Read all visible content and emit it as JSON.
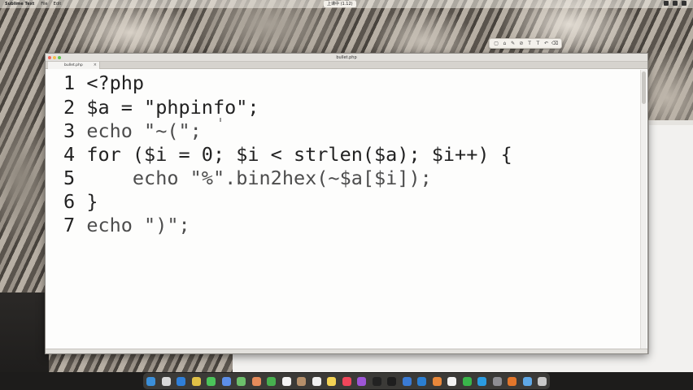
{
  "menubar": {
    "app_name": "Sublime Text",
    "items": [
      "File",
      "Edit"
    ],
    "center_label": "上课中 (1.12)"
  },
  "window": {
    "title": "bullet.php",
    "tab_label": "bullet.php",
    "tab_close": "×"
  },
  "editor": {
    "lines": [
      {
        "no": "1",
        "code": "<?php"
      },
      {
        "no": "2",
        "code": "$a = \"phpinfo\";"
      },
      {
        "no": "3",
        "code": "echo \"~(\";"
      },
      {
        "no": "4",
        "code": "for ($i = 0; $i < strlen($a); $i++) {"
      },
      {
        "no": "5",
        "code": "    echo \"%\".bin2hex(~$a[$i]);"
      },
      {
        "no": "6",
        "code": "}"
      },
      {
        "no": "7",
        "code": "echo \")\";"
      }
    ]
  },
  "float_toolbar": {
    "tools": [
      "▢",
      "⌂",
      "✎",
      "⊘",
      "T",
      "T",
      "↶",
      "⌫"
    ]
  },
  "dock": {
    "icons": [
      {
        "name": "finder-icon",
        "color": "#3b8fd9"
      },
      {
        "name": "launchpad-icon",
        "color": "#d9d9d9"
      },
      {
        "name": "safari-icon",
        "color": "#2f7fd8"
      },
      {
        "name": "chrome-icon",
        "color": "#e0c146"
      },
      {
        "name": "messages-icon",
        "color": "#4bc35a"
      },
      {
        "name": "mail-icon",
        "color": "#5c8ee8"
      },
      {
        "name": "maps-icon",
        "color": "#6cbf6b"
      },
      {
        "name": "photos-icon",
        "color": "#e58b5a"
      },
      {
        "name": "facetime-icon",
        "color": "#47b04f"
      },
      {
        "name": "calendar-icon",
        "color": "#f4f4f4"
      },
      {
        "name": "contacts-icon",
        "color": "#b58f6a"
      },
      {
        "name": "reminders-icon",
        "color": "#f0f0f0"
      },
      {
        "name": "notes-icon",
        "color": "#f3d354"
      },
      {
        "name": "music-icon",
        "color": "#f0465a"
      },
      {
        "name": "podcasts-icon",
        "color": "#9d55d6"
      },
      {
        "name": "tv-icon",
        "color": "#222222"
      },
      {
        "name": "terminal-icon",
        "color": "#1e1e1e"
      },
      {
        "name": "xcode-icon",
        "color": "#3a7bd5"
      },
      {
        "name": "vscode-icon",
        "color": "#2b7fd2"
      },
      {
        "name": "sublime-icon",
        "color": "#e8873a"
      },
      {
        "name": "textedit-icon",
        "color": "#f2f2f2"
      },
      {
        "name": "wechat-icon",
        "color": "#39b54a"
      },
      {
        "name": "qq-icon",
        "color": "#2a9be0"
      },
      {
        "name": "settings-icon",
        "color": "#8e8e93"
      },
      {
        "name": "burp-icon",
        "color": "#e2762b"
      },
      {
        "name": "folder-icon",
        "color": "#5fa8e6"
      },
      {
        "name": "trash-icon",
        "color": "#c8c8c8"
      }
    ]
  }
}
